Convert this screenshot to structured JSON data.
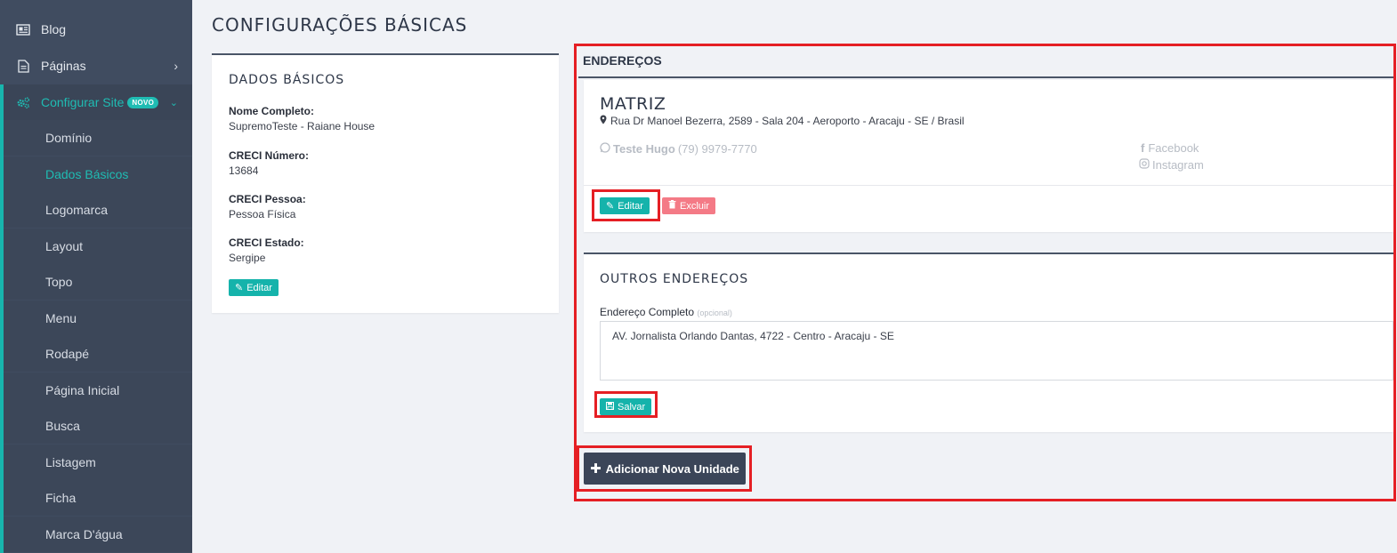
{
  "sidebar": {
    "items": [
      {
        "label": "Blog"
      },
      {
        "label": "Páginas"
      },
      {
        "label": "Configurar Site",
        "badge": "NOVO"
      }
    ],
    "subitems": [
      {
        "label": "Domínio"
      },
      {
        "label": "Dados Básicos"
      },
      {
        "label": "Logomarca"
      },
      {
        "label": "Layout"
      },
      {
        "label": "Topo"
      },
      {
        "label": "Menu"
      },
      {
        "label": "Rodapé"
      },
      {
        "label": "Página Inicial"
      },
      {
        "label": "Busca"
      },
      {
        "label": "Listagem"
      },
      {
        "label": "Ficha"
      },
      {
        "label": "Marca D'água"
      }
    ]
  },
  "page": {
    "title": "CONFIGURAÇÕES BÁSICAS"
  },
  "dados": {
    "title": "DADOS BÁSICOS",
    "fields": [
      {
        "label": "Nome Completo:",
        "value": "SupremoTeste - Raiane House"
      },
      {
        "label": "CRECI Número:",
        "value": "13684"
      },
      {
        "label": "CRECI Pessoa:",
        "value": "Pessoa Física"
      },
      {
        "label": "CRECI Estado:",
        "value": "Sergipe"
      }
    ],
    "edit_label": "Editar"
  },
  "enderecos": {
    "title": "ENDEREÇOS",
    "matriz": {
      "name": "MATRIZ",
      "address": "Rua Dr Manoel Bezerra, 2589 - Sala 204 - Aeroporto - Aracaju - SE / Brasil",
      "contact_name": "Teste Hugo",
      "contact_phone": "(79) 9979-7770",
      "facebook": "Facebook",
      "instagram": "Instagram",
      "edit_label": "Editar",
      "delete_label": "Excluir"
    },
    "outros": {
      "title": "OUTROS ENDEREÇOS",
      "field_label": "Endereço Completo",
      "field_hint": "(opcional)",
      "field_value": "AV. Jornalista Orlando Dantas, 4722 - Centro - Aracaju - SE",
      "save_label": "Salvar"
    },
    "add_label": "Adicionar Nova Unidade"
  },
  "colors": {
    "accent": "#15b3ab",
    "sidebar": "#404c60",
    "highlight": "#e51f24",
    "danger": "#f47a86"
  }
}
